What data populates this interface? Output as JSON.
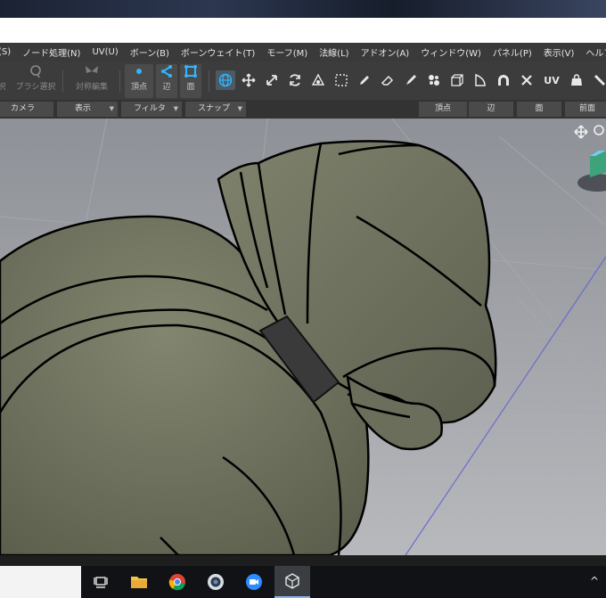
{
  "menu": {
    "items": [
      "(S)",
      "ノード処理(N)",
      "UV(U)",
      "ボーン(B)",
      "ボーンウェイト(T)",
      "モーフ(M)",
      "法線(L)",
      "アドオン(A)",
      "ウィンドウ(W)",
      "パネル(P)",
      "表示(V)",
      "ヘルプ(H)"
    ]
  },
  "toolbar": {
    "partial_label": "択",
    "brush_select": "ブラシ選択",
    "symmetric_edit": "対称編集",
    "vertex": "頂点",
    "edge": "辺",
    "face": "面",
    "icons": [
      "globe-icon",
      "move-icon",
      "scale-icon",
      "rotate-icon",
      "pivot-icon",
      "rect-select-icon",
      "pencil-icon",
      "eraser-icon",
      "brush-icon",
      "shuffle-icon",
      "cube-icon",
      "shape-icon",
      "arch-icon",
      "close-x-icon",
      "uv-icon",
      "bag-icon",
      "wrench-icon"
    ]
  },
  "filters": {
    "camera": "カメラ",
    "view": "表示",
    "filter": "フィルタ",
    "snap": "スナップ",
    "vertex_btn": "頂点",
    "edge_btn": "辺",
    "face_btn": "面",
    "front_btn": "前面"
  },
  "taskbar": {
    "apps": [
      "task-view-icon",
      "file-explorer-icon",
      "chrome-icon",
      "webcam-icon",
      "zoom-icon",
      "modeling-app-icon"
    ],
    "tray": "^"
  },
  "colors": {
    "accent": "#2fb6ff",
    "mesh_fill": "#6f725f",
    "outline": "#000000",
    "bow_band": "#3a3a3a"
  }
}
